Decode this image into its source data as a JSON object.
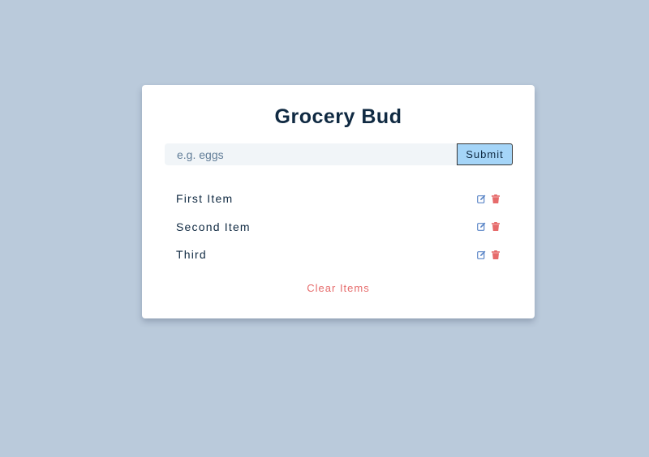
{
  "app": {
    "title": "Grocery Bud"
  },
  "form": {
    "input_value": "",
    "input_placeholder": "e.g. eggs",
    "submit_label": "Submit"
  },
  "items": [
    {
      "label": "First Item"
    },
    {
      "label": "Second Item"
    },
    {
      "label": "Third"
    }
  ],
  "icons": {
    "edit": "edit-icon",
    "delete": "trash-icon"
  },
  "clear_label": "Clear Items",
  "colors": {
    "background": "#bacadb",
    "card": "#ffffff",
    "title": "#102a42",
    "submit_bg": "#a5d5f8",
    "edit_icon": "#5b86c7",
    "delete_icon": "#e66b6b",
    "clear_text": "#e66b6b"
  }
}
